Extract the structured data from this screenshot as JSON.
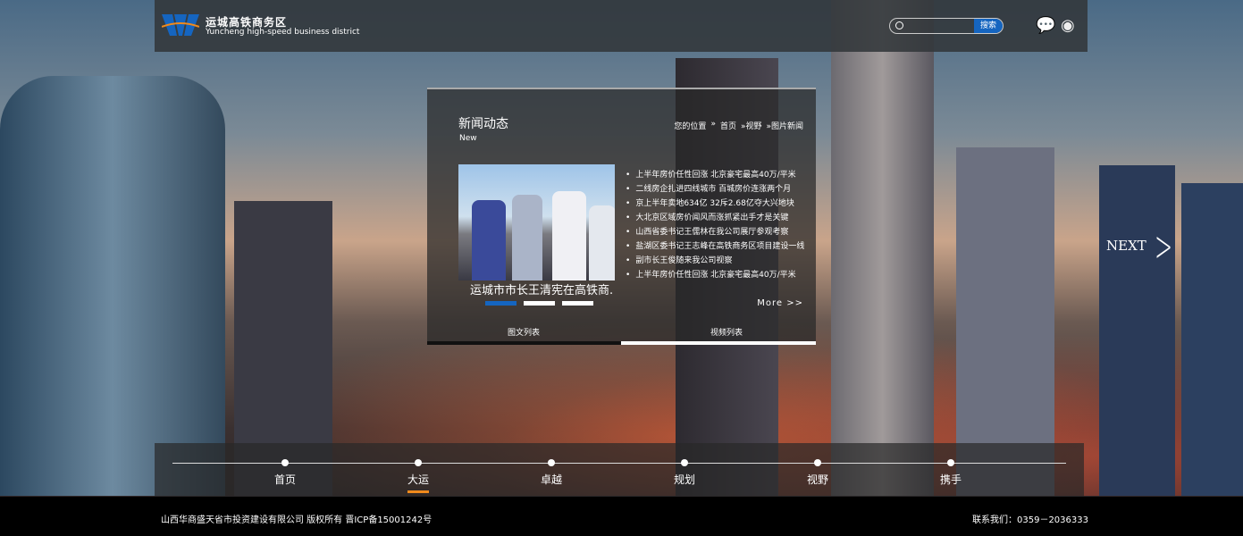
{
  "header": {
    "title_cn": "运城高铁商务区",
    "title_en": "Yuncheng high-speed business district",
    "search_placeholder": "",
    "search_button": "搜索",
    "icons": [
      "wechat-icon",
      "weibo-icon"
    ]
  },
  "panel": {
    "title": "新闻动态",
    "subtitle": "New",
    "breadcrumb": [
      "您的位置",
      "»",
      "首页",
      "»视野",
      "»图片新闻"
    ],
    "photo_caption": "运城市市长王清宪在高铁商.",
    "news": [
      "上半年房价任性回涨 北京豪宅最高40万/平米",
      "二线房企扎进四线城市 百城房价连涨两个月",
      "京上半年卖地634亿 32斥2.68亿夺大兴地块",
      "大北京区域房价闻风而涨抓紧出手才是关键",
      "山西省委书记王儒林在我公司展厅参观考察",
      "盐湖区委书记王志峰在高铁商务区项目建设一线",
      "副市长王俊随来我公司视察",
      "上半年房价任性回涨 北京豪宅最高40万/平米"
    ],
    "more": "More >>",
    "tabs": [
      "图文列表",
      "视频列表"
    ],
    "active_tab": 0,
    "active_slide": 0
  },
  "next_label": "NEXT",
  "nav": {
    "items": [
      "首页",
      "大运",
      "卓越",
      "规划",
      "视野",
      "携手"
    ],
    "active": 1
  },
  "footer": {
    "copyright": "山西华商盛天省市投资建设有限公司  版权所有  晋ICP备15001242号",
    "contact": "联系我们：0359－2036333"
  },
  "colors": {
    "accent": "#1565c0",
    "active_nav": "#f08a1c"
  }
}
